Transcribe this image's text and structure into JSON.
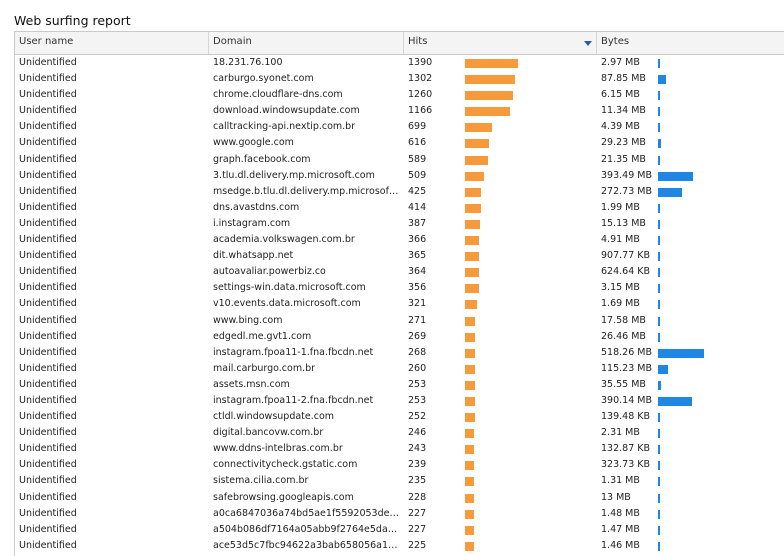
{
  "report": {
    "title": "Web surfing report",
    "columns": {
      "user": "User name",
      "domain": "Domain",
      "hits": "Hits",
      "bytes": "Bytes"
    },
    "sort": {
      "column": "hits",
      "direction": "descending"
    },
    "colors": {
      "hits_bar": "#f79a3c",
      "bytes_bar": "#1f86e3"
    },
    "max_hits": 1390,
    "max_bytes_mb": 907.77,
    "rows": [
      {
        "user": "Unidentified",
        "domain": "18.231.76.100",
        "hits": "1390",
        "hits_value": 1390,
        "bytes": "2.97 MB",
        "bytes_mb": 2.97
      },
      {
        "user": "Unidentified",
        "domain": "carburgo.syonet.com",
        "hits": "1302",
        "hits_value": 1302,
        "bytes": "87.85 MB",
        "bytes_mb": 87.85
      },
      {
        "user": "Unidentified",
        "domain": "chrome.cloudflare-dns.com",
        "hits": "1260",
        "hits_value": 1260,
        "bytes": "6.15 MB",
        "bytes_mb": 6.15
      },
      {
        "user": "Unidentified",
        "domain": "download.windowsupdate.com",
        "hits": "1166",
        "hits_value": 1166,
        "bytes": "11.34 MB",
        "bytes_mb": 11.34
      },
      {
        "user": "Unidentified",
        "domain": "calltracking-api.nextip.com.br",
        "hits": "699",
        "hits_value": 699,
        "bytes": "4.39 MB",
        "bytes_mb": 4.39
      },
      {
        "user": "Unidentified",
        "domain": "www.google.com",
        "hits": "616",
        "hits_value": 616,
        "bytes": "29.23 MB",
        "bytes_mb": 29.23
      },
      {
        "user": "Unidentified",
        "domain": "graph.facebook.com",
        "hits": "589",
        "hits_value": 589,
        "bytes": "21.35 MB",
        "bytes_mb": 21.35
      },
      {
        "user": "Unidentified",
        "domain": "3.tlu.dl.delivery.mp.microsoft.com",
        "hits": "509",
        "hits_value": 509,
        "bytes": "393.49 MB",
        "bytes_mb": 393.49
      },
      {
        "user": "Unidentified",
        "domain": "msedge.b.tlu.dl.delivery.mp.microsoft.co...",
        "hits": "425",
        "hits_value": 425,
        "bytes": "272.73 MB",
        "bytes_mb": 272.73
      },
      {
        "user": "Unidentified",
        "domain": "dns.avastdns.com",
        "hits": "414",
        "hits_value": 414,
        "bytes": "1.99 MB",
        "bytes_mb": 1.99
      },
      {
        "user": "Unidentified",
        "domain": "i.instagram.com",
        "hits": "387",
        "hits_value": 387,
        "bytes": "15.13 MB",
        "bytes_mb": 15.13
      },
      {
        "user": "Unidentified",
        "domain": "academia.volkswagen.com.br",
        "hits": "366",
        "hits_value": 366,
        "bytes": "4.91 MB",
        "bytes_mb": 4.91
      },
      {
        "user": "Unidentified",
        "domain": "dit.whatsapp.net",
        "hits": "365",
        "hits_value": 365,
        "bytes": "907.77 KB",
        "bytes_mb": 0.89
      },
      {
        "user": "Unidentified",
        "domain": "autoavaliar.powerbiz.co",
        "hits": "364",
        "hits_value": 364,
        "bytes": "624.64 KB",
        "bytes_mb": 0.61
      },
      {
        "user": "Unidentified",
        "domain": "settings-win.data.microsoft.com",
        "hits": "356",
        "hits_value": 356,
        "bytes": "3.15 MB",
        "bytes_mb": 3.15
      },
      {
        "user": "Unidentified",
        "domain": "v10.events.data.microsoft.com",
        "hits": "321",
        "hits_value": 321,
        "bytes": "1.69 MB",
        "bytes_mb": 1.69
      },
      {
        "user": "Unidentified",
        "domain": "www.bing.com",
        "hits": "271",
        "hits_value": 271,
        "bytes": "17.58 MB",
        "bytes_mb": 17.58
      },
      {
        "user": "Unidentified",
        "domain": "edgedl.me.gvt1.com",
        "hits": "269",
        "hits_value": 269,
        "bytes": "26.46 MB",
        "bytes_mb": 26.46
      },
      {
        "user": "Unidentified",
        "domain": "instagram.fpoa11-1.fna.fbcdn.net",
        "hits": "268",
        "hits_value": 268,
        "bytes": "518.26 MB",
        "bytes_mb": 518.26
      },
      {
        "user": "Unidentified",
        "domain": "mail.carburgo.com.br",
        "hits": "260",
        "hits_value": 260,
        "bytes": "115.23 MB",
        "bytes_mb": 115.23
      },
      {
        "user": "Unidentified",
        "domain": "assets.msn.com",
        "hits": "253",
        "hits_value": 253,
        "bytes": "35.55 MB",
        "bytes_mb": 35.55
      },
      {
        "user": "Unidentified",
        "domain": "instagram.fpoa11-2.fna.fbcdn.net",
        "hits": "253",
        "hits_value": 253,
        "bytes": "390.14 MB",
        "bytes_mb": 390.14
      },
      {
        "user": "Unidentified",
        "domain": "ctldl.windowsupdate.com",
        "hits": "252",
        "hits_value": 252,
        "bytes": "139.48 KB",
        "bytes_mb": 0.14
      },
      {
        "user": "Unidentified",
        "domain": "digital.bancovw.com.br",
        "hits": "246",
        "hits_value": 246,
        "bytes": "2.31 MB",
        "bytes_mb": 2.31
      },
      {
        "user": "Unidentified",
        "domain": "www.ddns-intelbras.com.br",
        "hits": "243",
        "hits_value": 243,
        "bytes": "132.87 KB",
        "bytes_mb": 0.13
      },
      {
        "user": "Unidentified",
        "domain": "connectivitycheck.gstatic.com",
        "hits": "239",
        "hits_value": 239,
        "bytes": "323.73 KB",
        "bytes_mb": 0.32
      },
      {
        "user": "Unidentified",
        "domain": "sistema.cilia.com.br",
        "hits": "235",
        "hits_value": 235,
        "bytes": "1.31 MB",
        "bytes_mb": 1.31
      },
      {
        "user": "Unidentified",
        "domain": "safebrowsing.googleapis.com",
        "hits": "228",
        "hits_value": 228,
        "bytes": "13 MB",
        "bytes_mb": 13
      },
      {
        "user": "Unidentified",
        "domain": "a0ca6847036a74bd5ae1f5592053deda...",
        "hits": "227",
        "hits_value": 227,
        "bytes": "1.48 MB",
        "bytes_mb": 1.48
      },
      {
        "user": "Unidentified",
        "domain": "a504b086df7164a05abb9f2764e5da72-...",
        "hits": "227",
        "hits_value": 227,
        "bytes": "1.47 MB",
        "bytes_mb": 1.47
      },
      {
        "user": "Unidentified",
        "domain": "ace53d5c7fbc94622a3bab658056a1c2-...",
        "hits": "225",
        "hits_value": 225,
        "bytes": "1.46 MB",
        "bytes_mb": 1.46
      }
    ]
  }
}
